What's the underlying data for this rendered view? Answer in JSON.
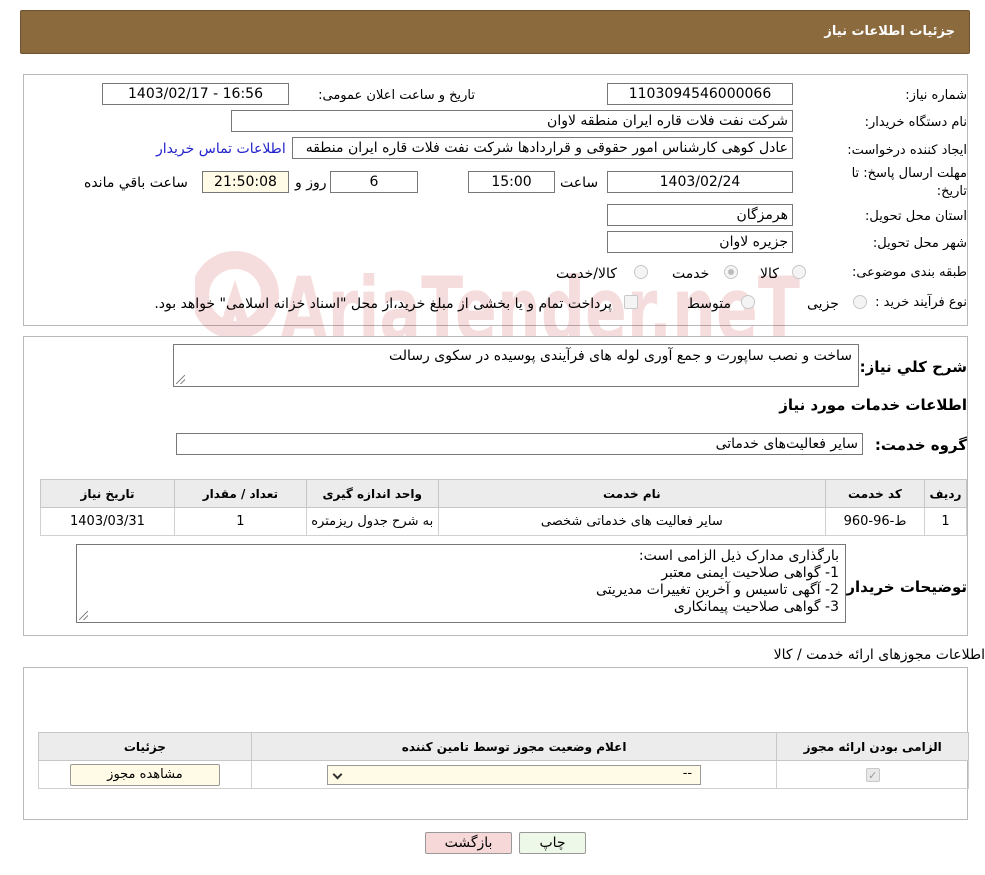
{
  "header": {
    "title": "جزئیات اطلاعات نیاز"
  },
  "details": {
    "need_number_label": "شماره نیاز:",
    "need_number": "1103094546000066",
    "announce_label": "تاریخ و ساعت اعلان عمومی:",
    "announce_value": "1403/02/17 - 16:56",
    "buyer_org_label": "نام دستگاه خریدار:",
    "buyer_org": "شرکت نفت فلات قاره ایران منطقه لاوان",
    "creator_label": "ایجاد کننده درخواست:",
    "creator": "عادل کوهی کارشناس امور حقوقی و قراردادها شرکت نفت فلات قاره ایران منطقه",
    "contact_link": "اطلاعات تماس خریدار",
    "deadline_label_1": "مهلت ارسال پاسخ: تا",
    "deadline_label_2": "تاریخ:",
    "deadline_date": "1403/02/24",
    "time_label": "ساعت",
    "deadline_time": "15:00",
    "days_value": "6",
    "day_and_label": "روز و",
    "remaining_time": "21:50:08",
    "remaining_label": "ساعت باقي مانده",
    "province_label": "استان محل تحویل:",
    "province": "هرمزگان",
    "city_label": "شهر محل تحویل:",
    "city": "جزیره لاوان",
    "category_label": "طبقه بندی موضوعی:",
    "category_options": [
      "کالا",
      "خدمت",
      "کالا/خدمت"
    ],
    "category_selected": 1,
    "process_label": "نوع فرآیند خرید :",
    "process_options": [
      "جزیی",
      "متوسط"
    ],
    "payment_note": "پرداخت تمام و یا بخشی از مبلغ خرید،از محل \"اسناد خزانه اسلامی\" خواهد بود."
  },
  "service": {
    "summary_label": "شرح کلي نياز:",
    "summary": "ساخت و نصب ساپورت و جمع آوری لوله های فرآیندی پوسیده در سکوی رسالت",
    "services_heading": "اطلاعات خدمات مورد نیاز",
    "group_label": "گروه خدمت:",
    "group": "سایر فعالیت‌های خدماتی",
    "table_headers": [
      "ردیف",
      "کد خدمت",
      "نام خدمت",
      "واحد اندازه گیری",
      "تعداد / مقدار",
      "تاریخ نیاز"
    ],
    "rows": [
      [
        "1",
        "ط-96-960",
        "سایر فعالیت های خدماتی شخصی",
        "به شرح جدول ریزمتره",
        "1",
        "1403/03/31"
      ]
    ],
    "buyer_notes_label": "توضیحات خریدار:",
    "buyer_notes": [
      "بارگذاری مدارک ذیل الزامی است:",
      "1-     گواهی صلاحیت ایمنی معتبر",
      "2-     آگهی تاسیس و آخرین تغییرات مدیریتی",
      "3-     گواهی صلاحیت پیمانکاری"
    ]
  },
  "permits": {
    "title": "اطلاعات مجوزهای ارائه خدمت / کالا",
    "headers": [
      "الزامی بودن ارائه مجوز",
      "اعلام وضعیت مجوز توسط تامین کننده",
      "جزئیات"
    ],
    "select_value": "--",
    "view_button": "مشاهده مجوز"
  },
  "actions": {
    "print": "چاپ",
    "back": "بازگشت"
  },
  "watermark_text": "AriaTender.neT",
  "colors": {
    "header_bg": "#8b6a3e",
    "back_btn_bg": "#f6d8d8",
    "print_btn_bg": "#eef8e8",
    "link": "#2222cc"
  }
}
